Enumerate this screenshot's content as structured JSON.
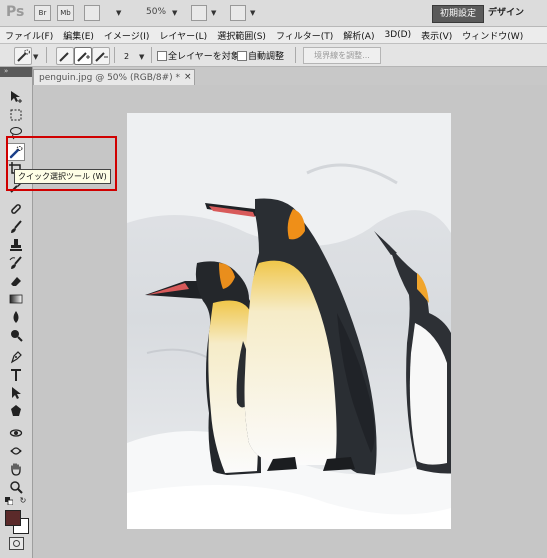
{
  "appbar": {
    "logo": "Ps",
    "btn_bridge": "Br",
    "btn_minibridge": "Mb",
    "zoom": "50%",
    "workspace_active": "初期設定",
    "workspace_design": "デザイン"
  },
  "menu": [
    "ファイル(F)",
    "編集(E)",
    "イメージ(I)",
    "レイヤー(L)",
    "選択範囲(S)",
    "フィルター(T)",
    "解析(A)",
    "3D(D)",
    "表示(V)",
    "ウィンドウ(W)"
  ],
  "options": {
    "brush_size": "2",
    "sample_all_layers": "全レイヤーを対象",
    "auto_enhance": "自動調整",
    "refine_edge": "境界線を調整..."
  },
  "document": {
    "tab_title": "penguin.jpg @ 50% (RGB/8#) *",
    "close": "×"
  },
  "tooltip": "クイック選択ツール (W)",
  "colors": {
    "foreground": "#5b2a2a",
    "background": "#ffffff",
    "highlight": "#d00000"
  },
  "icons": [
    "move-icon",
    "marquee-icon",
    "lasso-icon",
    "quick-selection-icon",
    "crop-icon",
    "eyedropper-icon",
    "spot-healing-icon",
    "brush-icon",
    "clone-stamp-icon",
    "history-brush-icon",
    "eraser-icon",
    "gradient-icon",
    "blur-icon",
    "dodge-icon",
    "pen-icon",
    "type-icon",
    "path-selection-icon",
    "shape-icon",
    "3d-rotate-icon",
    "3d-orbit-icon",
    "hand-icon",
    "zoom-icon"
  ]
}
